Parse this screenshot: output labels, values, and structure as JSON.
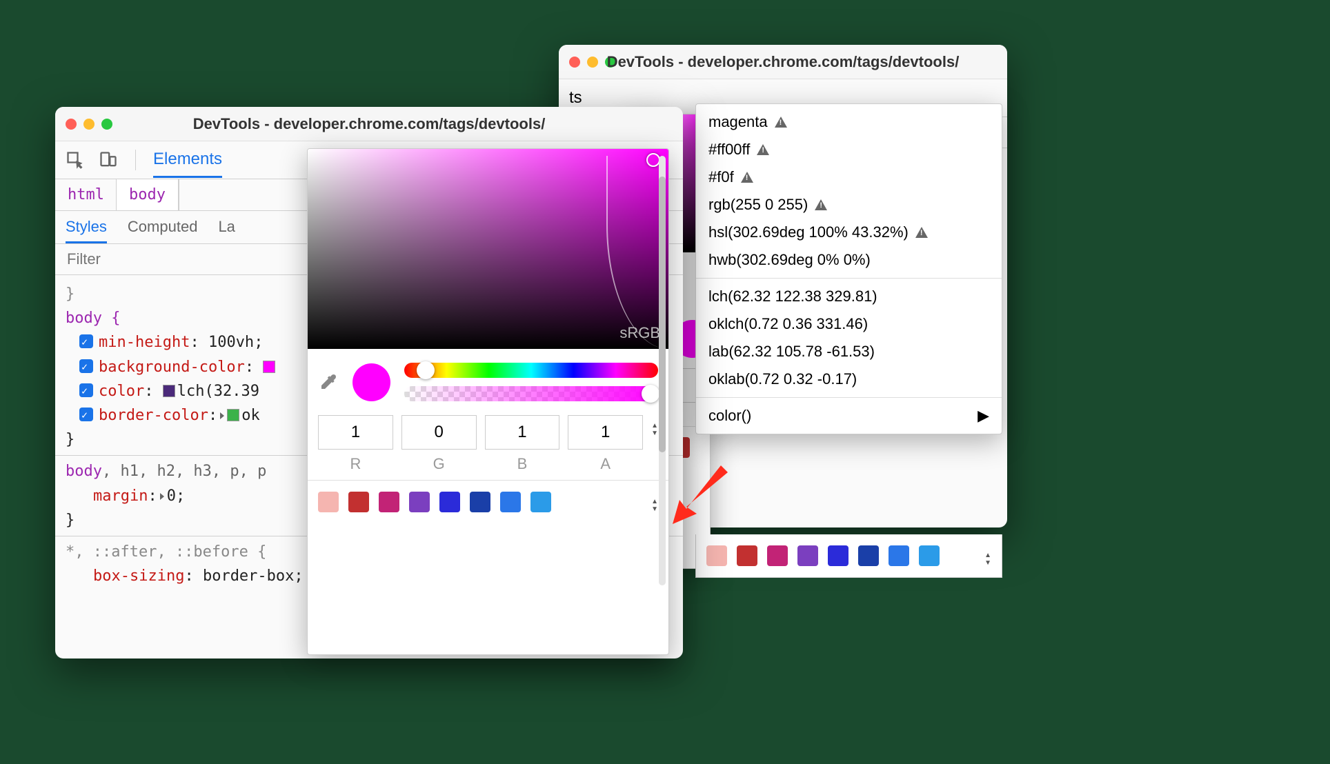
{
  "window": {
    "title": "DevTools - developer.chrome.com/tags/devtools/"
  },
  "toolbar": {
    "tab_elements": "Elements",
    "tab_ts": "ts"
  },
  "breadcrumb": {
    "html": "html",
    "body": "body"
  },
  "subtabs": {
    "styles": "Styles",
    "computed": "Computed",
    "layout_prefix": "La",
    "layout_prefix_back": "La"
  },
  "filter": {
    "placeholder": "Filter"
  },
  "css": {
    "body_sel": "body {",
    "min_height_prop": "min-height",
    "min_height_val": "100vh",
    "min_height_val_back": "0vh",
    "bg_prop": "background-color",
    "bg_swatch": "#ff00ff",
    "color_prop": "color",
    "color_val": "lch(32.39 ",
    "color_val_back": "2.39 ",
    "or_back": "or:",
    "color_swatch": "#4b2a7a",
    "border_prop": "border-color",
    "border_swatch": "#3bb24a",
    "border_trail": "ok",
    "back_ok": "ok",
    "close": "}",
    "rule2_sel": "body, h1, h2, h3, p, p",
    "rule2_sel_back": "p, p",
    "margin_prop": "margin",
    "margin_val": "0",
    "rule3_sel": "*, ::after, ::before {",
    "ore_back": "ore {",
    "boxs_prop": "box-sizing",
    "boxs_val": "border-box",
    "rder_box_back": "rder-box;"
  },
  "picker": {
    "space_label": "sRGB",
    "r_val": "1",
    "g_val": "0",
    "b_val": "1",
    "a_val": "1",
    "r_lab": "R",
    "g_lab": "G",
    "b_lab": "B",
    "a_lab": "A",
    "back": {
      "r_val": "1",
      "r_lab": "R"
    },
    "swatches": [
      "#f5b5b0",
      "#c23030",
      "#c22376",
      "#7b3fbf",
      "#2b2bd9",
      "#1a3fa8",
      "#2b77e8",
      "#2b9be8"
    ]
  },
  "menu": {
    "magenta": "magenta",
    "hex6": "#ff00ff",
    "hex3": "#f0f",
    "rgb": "rgb(255 0 255)",
    "hsl": "hsl(302.69deg 100% 43.32%)",
    "hwb": "hwb(302.69deg 0% 0%)",
    "lch": "lch(62.32 122.38 329.81)",
    "oklch": "oklch(0.72 0.36 331.46)",
    "lab": "lab(62.32 105.78 -61.53)",
    "oklab": "oklab(0.72 0.32 -0.17)",
    "color_fn": "color()"
  }
}
